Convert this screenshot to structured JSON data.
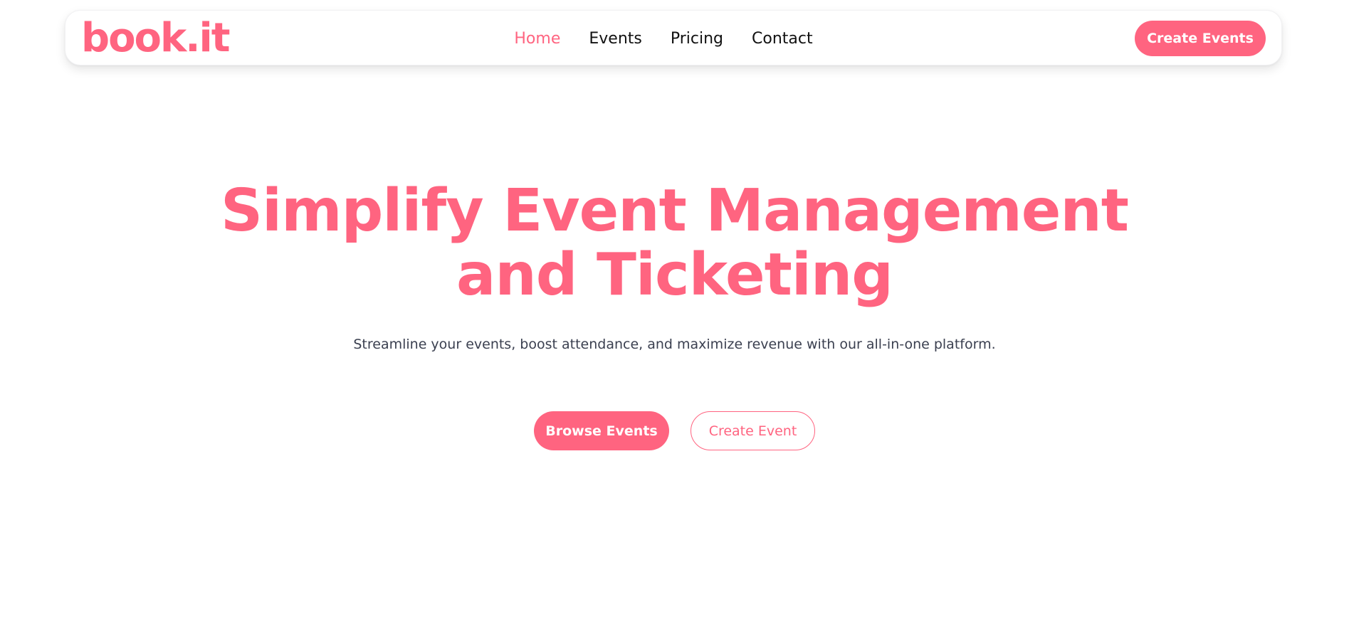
{
  "brand": {
    "logo_text": "book.it",
    "accent_color": "#ff6480"
  },
  "nav": {
    "items": [
      {
        "label": "Home",
        "active": true
      },
      {
        "label": "Events",
        "active": false
      },
      {
        "label": "Pricing",
        "active": false
      },
      {
        "label": "Contact",
        "active": false
      }
    ],
    "cta_label": "Create Events"
  },
  "hero": {
    "title_line1": "Simplify Event Management",
    "title_line2": "and Ticketing",
    "subtitle": "Streamline your events, boost attendance, and maximize revenue with our all-in-one platform.",
    "primary_button": "Browse Events",
    "secondary_button": "Create Event"
  }
}
